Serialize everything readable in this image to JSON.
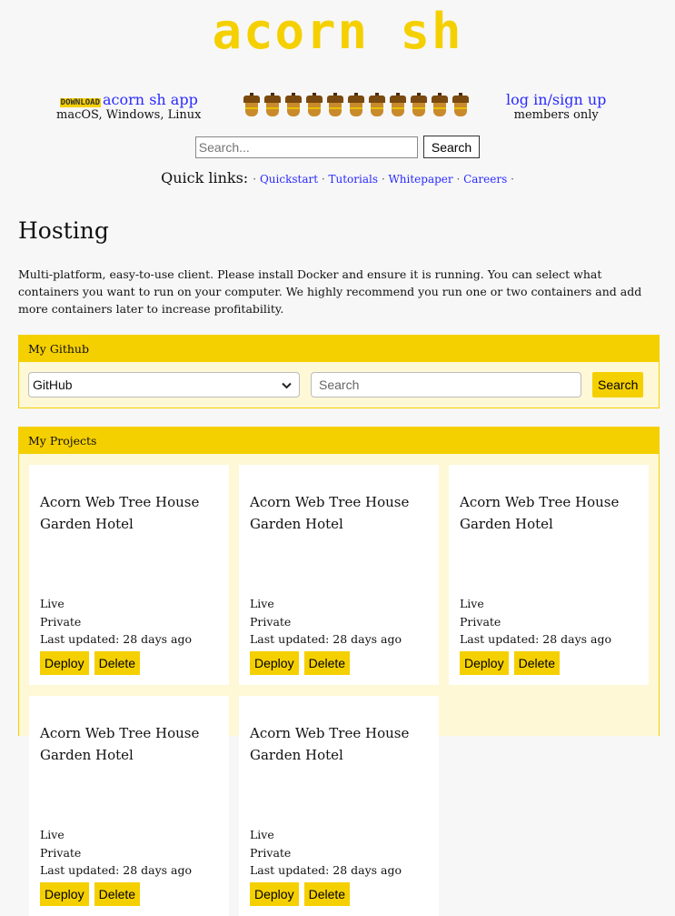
{
  "header": {
    "logo": "acorn sh",
    "download_badge": "DOWNLOAD",
    "download_link": "acorn sh app",
    "platforms": "macOS, Windows, Linux",
    "login_link": "log in/sign up",
    "login_note": "members only",
    "acorn_count": 11
  },
  "search": {
    "placeholder": "Search...",
    "button": "Search"
  },
  "quick_links": {
    "label": "Quick links:",
    "items": [
      "Quickstart",
      "Tutorials",
      "Whitepaper",
      "Careers"
    ]
  },
  "page": {
    "title": "Hosting",
    "intro": "Multi-platform, easy-to-use client. Please install Docker and ensure it is running. You can select what containers you want to run on your computer. We highly recommend you run one or two containers and add more containers later to increase profitability."
  },
  "github_panel": {
    "header": "My Github",
    "select_value": "GitHub",
    "search_placeholder": "Search",
    "search_button": "Search"
  },
  "projects_panel": {
    "header": "My Projects",
    "cards": [
      {
        "title": "Acorn Web Tree House Garden Hotel",
        "status": "Live",
        "visibility": "Private",
        "updated": "Last updated: 28 days ago",
        "deploy": "Deploy",
        "delete": "Delete"
      },
      {
        "title": "Acorn Web Tree House Garden Hotel",
        "status": "Live",
        "visibility": "Private",
        "updated": "Last updated: 28 days ago",
        "deploy": "Deploy",
        "delete": "Delete"
      },
      {
        "title": "Acorn Web Tree House Garden Hotel",
        "status": "Live",
        "visibility": "Private",
        "updated": "Last updated: 28 days ago",
        "deploy": "Deploy",
        "delete": "Delete"
      },
      {
        "title": "Acorn Web Tree House Garden Hotel",
        "status": "Live",
        "visibility": "Private",
        "updated": "Last updated: 28 days ago",
        "deploy": "Deploy",
        "delete": "Delete"
      },
      {
        "title": "Acorn Web Tree House Garden Hotel",
        "status": "Live",
        "visibility": "Private",
        "updated": "Last updated: 28 days ago",
        "deploy": "Deploy",
        "delete": "Delete"
      }
    ]
  },
  "colors": {
    "accent": "#f5d000",
    "link": "#2a2aff",
    "panel_bg": "#fff8d6",
    "page_bg": "#f7f7f7"
  }
}
